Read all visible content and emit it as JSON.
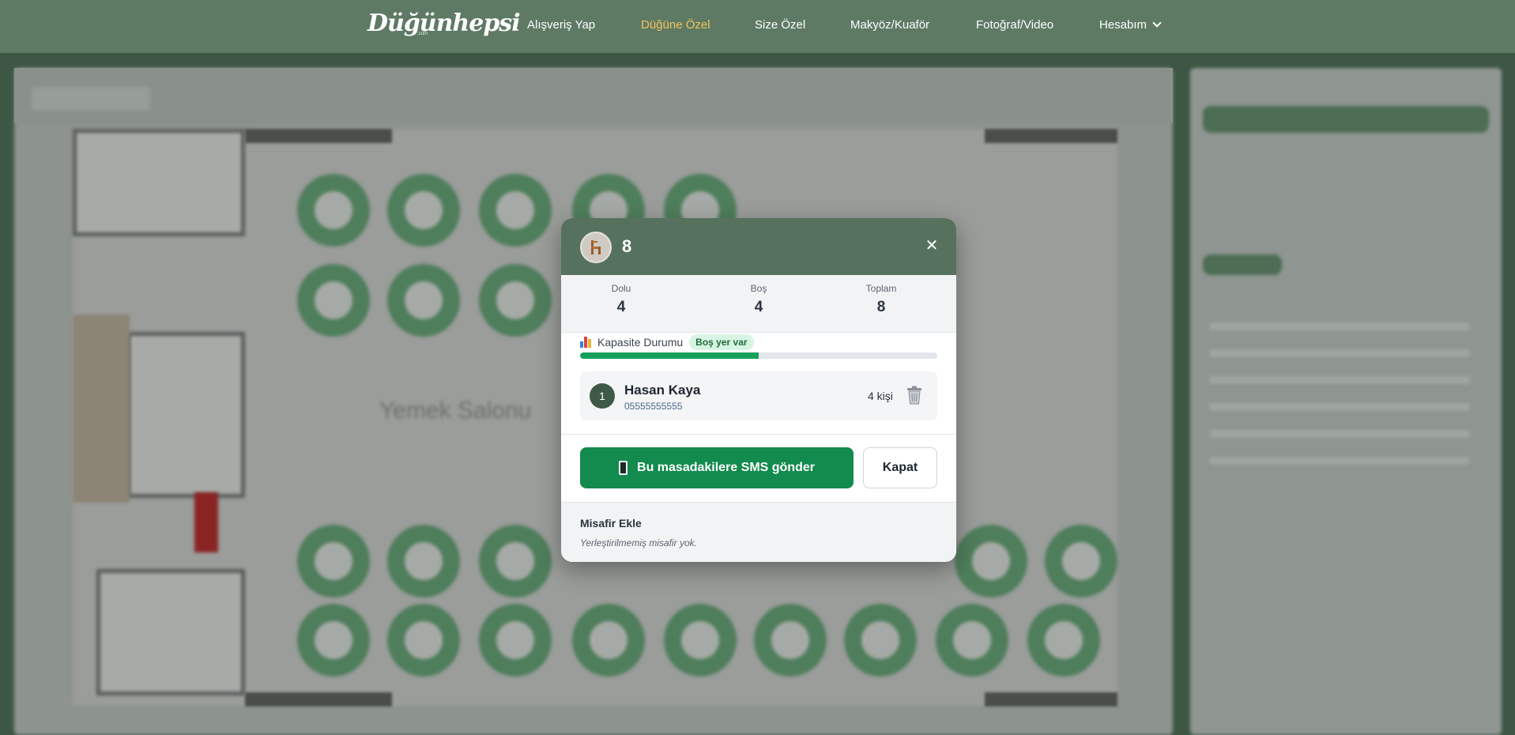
{
  "nav": {
    "logo": "Düğünhepsi",
    "logo_sub": ".com",
    "items": [
      {
        "label": "Alışveriş Yap",
        "active": false
      },
      {
        "label": "Düğüne Özel",
        "active": true
      },
      {
        "label": "Size Özel",
        "active": false
      },
      {
        "label": "Makyöz/Kuaför",
        "active": false
      },
      {
        "label": "Fotoğraf/Video",
        "active": false
      },
      {
        "label": "Hesabım",
        "active": false
      }
    ],
    "colors": {
      "background": "#5e7a65",
      "active": "#f4c35a"
    }
  },
  "background": {
    "hall_label": "Yemek Salonu"
  },
  "modal": {
    "icon": "chair-icon",
    "table_no": "8",
    "close_icon": "close-icon",
    "stats": {
      "dolu_label": "Dolu",
      "dolu_value": "4",
      "bos_label": "Boş",
      "bos_value": "4",
      "toplam_label": "Toplam",
      "toplam_value": "8"
    },
    "capacity": {
      "label": "Kapasite Durumu",
      "badge": "Boş yer var",
      "fill_fraction": 0.5
    },
    "guests": [
      {
        "order": "1",
        "name": "Hasan Kaya",
        "phone": "05555555555",
        "count": "4 kişi"
      }
    ],
    "sms_button": "Bu masadakilere SMS gönder",
    "close_button": "Kapat",
    "add_guest": {
      "title": "Misafir Ekle",
      "empty_text": "Yerleştirilmemiş misafir yok."
    },
    "colors": {
      "header": "#56725e",
      "primary": "#138a4e",
      "progress": "#14a05a"
    }
  }
}
